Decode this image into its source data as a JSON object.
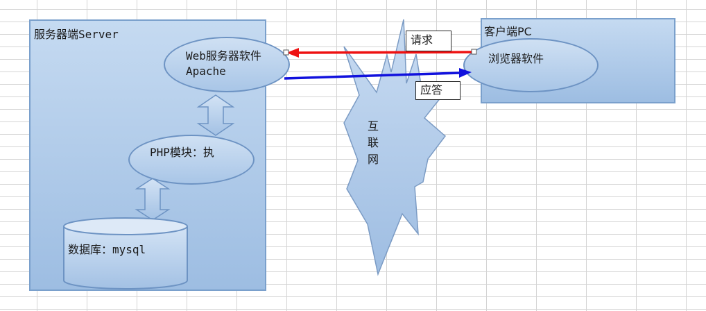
{
  "server": {
    "title": "服务器端Server",
    "web_server_label": "Web服务器软件Apache",
    "php_label": "PHP模块：执",
    "db_label": "数据库：mysql"
  },
  "client": {
    "title": "客户端PC",
    "browser_label": "浏览器软件"
  },
  "internet": {
    "label": "互联网"
  },
  "arrows": {
    "request_label": "请求",
    "response_label": "应答",
    "request_color": "#ee1111",
    "response_color": "#1111dd"
  },
  "colors": {
    "panel_fill": "#b8d1ee",
    "panel_border": "#7aa0cc",
    "shape_fill": "#bcd4ef",
    "shape_border": "#6d93c3"
  }
}
